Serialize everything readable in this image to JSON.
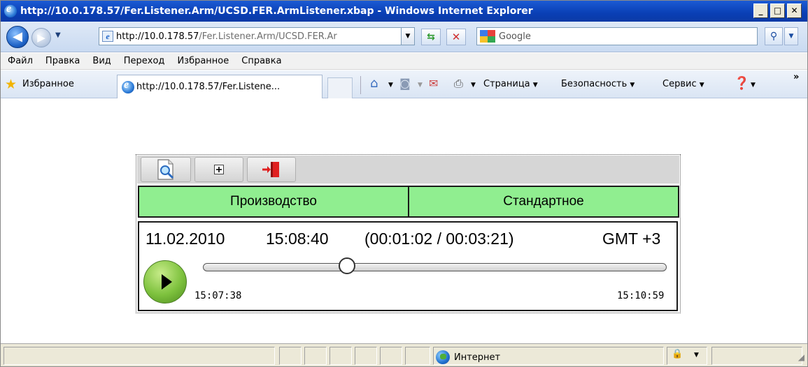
{
  "window": {
    "title": "http://10.0.178.57/Fer.Listener.Arm/UCSD.FER.ArmListener.xbap - Windows Internet Explorer",
    "minimize": "_",
    "maximize": "□",
    "close": "✕"
  },
  "address": {
    "host": "http://10.0.178.57",
    "path": "/Fer.Listener.Arm/UCSD.FER.Ar"
  },
  "search": {
    "placeholder": "Google"
  },
  "menu": [
    "Файл",
    "Правка",
    "Вид",
    "Переход",
    "Избранное",
    "Справка"
  ],
  "favorites": {
    "label": "Избранное",
    "tab_title": "http://10.0.178.57/Fer.Listene..."
  },
  "commands": {
    "page": "Страница",
    "safety": "Безопасность",
    "tools": "Сервис",
    "more": "»"
  },
  "app": {
    "tabs": [
      "Производство",
      "Стандартное"
    ],
    "date": "11.02.2010",
    "time": "15:08:40",
    "position": "(00:01:02 / 00:03:21)",
    "timezone": "GMT +3",
    "start": "15:07:38",
    "end": "15:10:59",
    "progress_fraction": 0.31
  },
  "status": {
    "zone": "Интернет"
  }
}
